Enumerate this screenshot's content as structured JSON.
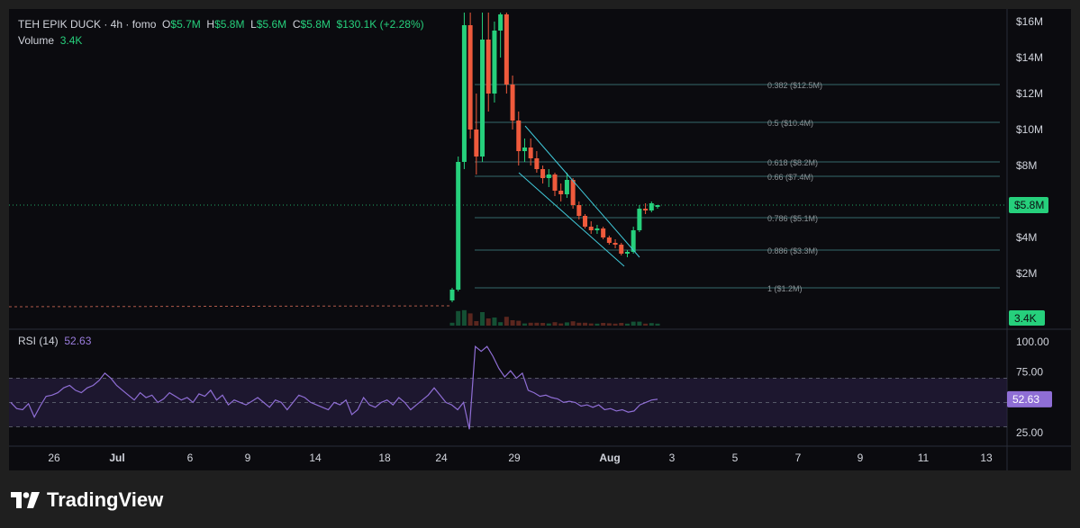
{
  "legend": {
    "symbol": "TEH EPIK DUCK · 4h · fomo",
    "o_label": "O",
    "o_value": "$5.7M",
    "h_label": "H",
    "h_value": "$5.8M",
    "l_label": "L",
    "l_value": "$5.6M",
    "c_label": "C",
    "c_value": "$5.8M",
    "change": "$130.1K (+2.28%)",
    "volume_label": "Volume",
    "volume_value": "3.4K",
    "rsi_label": "RSI (14)",
    "rsi_value": "52.63"
  },
  "brand": {
    "name": "TradingView"
  },
  "colors": {
    "up": "#26d07c",
    "down": "#ef5a3c",
    "fib": "#56b3b3",
    "rsi": "#8f6ed5",
    "rsi_band": "#2a1f44",
    "price_tag": "#26d07c"
  },
  "chart_data": [
    {
      "type": "candlestick",
      "title": "TEH EPIK DUCK · 4h · fomo",
      "y_ticks": [
        "$16M",
        "$14M",
        "$12M",
        "$10M",
        "$8M",
        "$4M",
        "$2M"
      ],
      "y_tick_values": [
        16,
        14,
        12,
        10,
        8,
        4,
        2
      ],
      "ylim": [
        0,
        16.5
      ],
      "x_ticks": [
        "26",
        "Jul",
        "6",
        "9",
        "14",
        "18",
        "24",
        "29",
        "Aug",
        "3",
        "5",
        "7",
        "9",
        "11",
        "13"
      ],
      "last_price_label": "$5.8M",
      "last_price": 5.8,
      "volume_label": "3.4K",
      "fib_levels": [
        {
          "label": "0.382 ($12.5M)",
          "value": 12.5
        },
        {
          "label": "0.5 ($10.4M)",
          "value": 10.4
        },
        {
          "label": "0.618 ($8.2M)",
          "value": 8.2
        },
        {
          "label": "0.66 ($7.4M)",
          "value": 7.4
        },
        {
          "label": "0.786 ($5.1M)",
          "value": 5.1
        },
        {
          "label": "0.886 ($3.3M)",
          "value": 3.3
        },
        {
          "label": "1 ($1.2M)",
          "value": 1.2
        }
      ],
      "candles": [
        {
          "o": 0.5,
          "h": 1.2,
          "l": 0.4,
          "c": 1.1
        },
        {
          "o": 1.1,
          "h": 8.5,
          "l": 1.0,
          "c": 8.2
        },
        {
          "o": 8.2,
          "h": 16.5,
          "l": 7.8,
          "c": 15.8
        },
        {
          "o": 15.8,
          "h": 16.5,
          "l": 9.5,
          "c": 10.0
        },
        {
          "o": 10.0,
          "h": 12.0,
          "l": 7.5,
          "c": 8.5
        },
        {
          "o": 8.5,
          "h": 16.5,
          "l": 8.2,
          "c": 15.0
        },
        {
          "o": 15.0,
          "h": 16.5,
          "l": 11.0,
          "c": 12.0
        },
        {
          "o": 12.0,
          "h": 16.0,
          "l": 11.5,
          "c": 15.5
        },
        {
          "o": 15.5,
          "h": 16.5,
          "l": 14.0,
          "c": 16.4
        },
        {
          "o": 16.4,
          "h": 16.5,
          "l": 12.0,
          "c": 12.5
        },
        {
          "o": 12.5,
          "h": 13.0,
          "l": 10.0,
          "c": 10.5
        },
        {
          "o": 10.5,
          "h": 11.0,
          "l": 8.0,
          "c": 8.8
        },
        {
          "o": 8.8,
          "h": 9.5,
          "l": 8.2,
          "c": 9.0
        },
        {
          "o": 9.0,
          "h": 9.5,
          "l": 8.0,
          "c": 8.4
        },
        {
          "o": 8.4,
          "h": 8.8,
          "l": 7.6,
          "c": 7.8
        },
        {
          "o": 7.8,
          "h": 8.0,
          "l": 7.0,
          "c": 7.3
        },
        {
          "o": 7.3,
          "h": 7.8,
          "l": 6.8,
          "c": 7.5
        },
        {
          "o": 7.5,
          "h": 7.6,
          "l": 6.3,
          "c": 6.6
        },
        {
          "o": 6.6,
          "h": 7.0,
          "l": 6.0,
          "c": 6.4
        },
        {
          "o": 6.4,
          "h": 7.6,
          "l": 6.2,
          "c": 7.2
        },
        {
          "o": 7.2,
          "h": 7.3,
          "l": 5.6,
          "c": 5.8
        },
        {
          "o": 5.8,
          "h": 6.0,
          "l": 5.0,
          "c": 5.2
        },
        {
          "o": 5.2,
          "h": 5.3,
          "l": 4.5,
          "c": 4.6
        },
        {
          "o": 4.6,
          "h": 4.9,
          "l": 4.2,
          "c": 4.4
        },
        {
          "o": 4.4,
          "h": 4.7,
          "l": 4.2,
          "c": 4.5
        },
        {
          "o": 4.5,
          "h": 4.6,
          "l": 3.9,
          "c": 4.0
        },
        {
          "o": 4.0,
          "h": 4.1,
          "l": 3.6,
          "c": 3.7
        },
        {
          "o": 3.7,
          "h": 3.9,
          "l": 3.4,
          "c": 3.6
        },
        {
          "o": 3.6,
          "h": 3.7,
          "l": 3.0,
          "c": 3.1
        },
        {
          "o": 3.1,
          "h": 3.3,
          "l": 2.9,
          "c": 3.2
        },
        {
          "o": 3.2,
          "h": 4.6,
          "l": 3.1,
          "c": 4.4
        },
        {
          "o": 4.4,
          "h": 5.8,
          "l": 4.3,
          "c": 5.6
        },
        {
          "o": 5.6,
          "h": 5.9,
          "l": 5.3,
          "c": 5.5
        },
        {
          "o": 5.5,
          "h": 6.0,
          "l": 5.4,
          "c": 5.9
        },
        {
          "o": 5.7,
          "h": 5.8,
          "l": 5.6,
          "c": 5.8
        }
      ]
    },
    {
      "type": "line",
      "title": "RSI (14)",
      "y_ticks": [
        "100.00",
        "75.00",
        "25.00"
      ],
      "y_tick_values": [
        100,
        75,
        25
      ],
      "ylim": [
        20,
        105
      ],
      "bands": [
        30,
        70
      ],
      "mid": 50,
      "last_value_label": "52.63",
      "values": [
        50,
        45,
        44,
        49,
        38,
        47,
        55,
        56,
        58,
        62,
        64,
        60,
        58,
        62,
        64,
        68,
        74,
        70,
        64,
        60,
        56,
        52,
        58,
        54,
        56,
        50,
        53,
        58,
        55,
        52,
        54,
        50,
        57,
        55,
        60,
        52,
        56,
        48,
        52,
        50,
        48,
        51,
        54,
        50,
        46,
        52,
        50,
        44,
        50,
        56,
        54,
        50,
        48,
        46,
        44,
        50,
        48,
        52,
        40,
        44,
        54,
        48,
        46,
        50,
        52,
        48,
        54,
        50,
        44,
        48,
        52,
        56,
        62,
        56,
        50,
        48,
        44,
        50,
        28,
        96,
        92,
        96,
        88,
        78,
        71,
        76,
        70,
        74,
        60,
        58,
        55,
        56,
        54,
        53,
        50,
        51,
        50,
        47,
        48,
        46,
        48,
        44,
        45,
        43,
        44,
        42,
        43,
        48,
        50,
        52,
        52.63
      ]
    }
  ]
}
